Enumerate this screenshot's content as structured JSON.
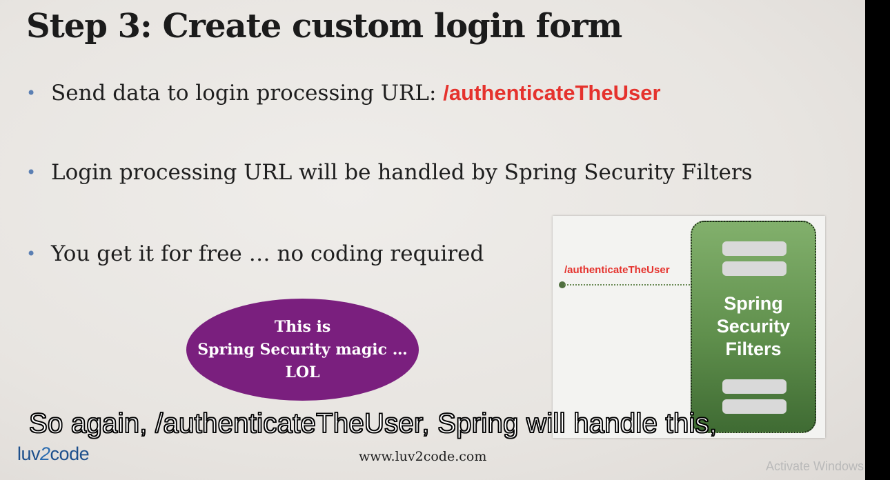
{
  "slide": {
    "title": "Step 3: Create custom login form",
    "bullets": [
      {
        "prefix": "Send data to login processing URL: ",
        "highlight": "/authenticateTheUser"
      },
      {
        "text": "Login processing URL will be handled by Spring Security Filters"
      },
      {
        "text": "You get it for free … no coding required"
      }
    ],
    "magic_bubble": {
      "line1": "This is",
      "line2": "Spring Security magic …",
      "line3": "LOL"
    },
    "diagram": {
      "url_label": "/authenticateTheUser",
      "filters_line1": "Spring",
      "filters_line2": "Security",
      "filters_line3": "Filters"
    },
    "footer_url": "www.luv2code.com",
    "logo": {
      "part1": "luv",
      "part2": "2",
      "part3": "code"
    }
  },
  "subtitle": "So again, /authenticateTheUser, Spring will handle this,",
  "watermark": "Activate Windows",
  "colors": {
    "accent_red": "#e5322d",
    "bubble_purple": "#7a1f7e",
    "filters_green": "#5f8f4c",
    "bullet_blue": "#5b7fb3"
  }
}
